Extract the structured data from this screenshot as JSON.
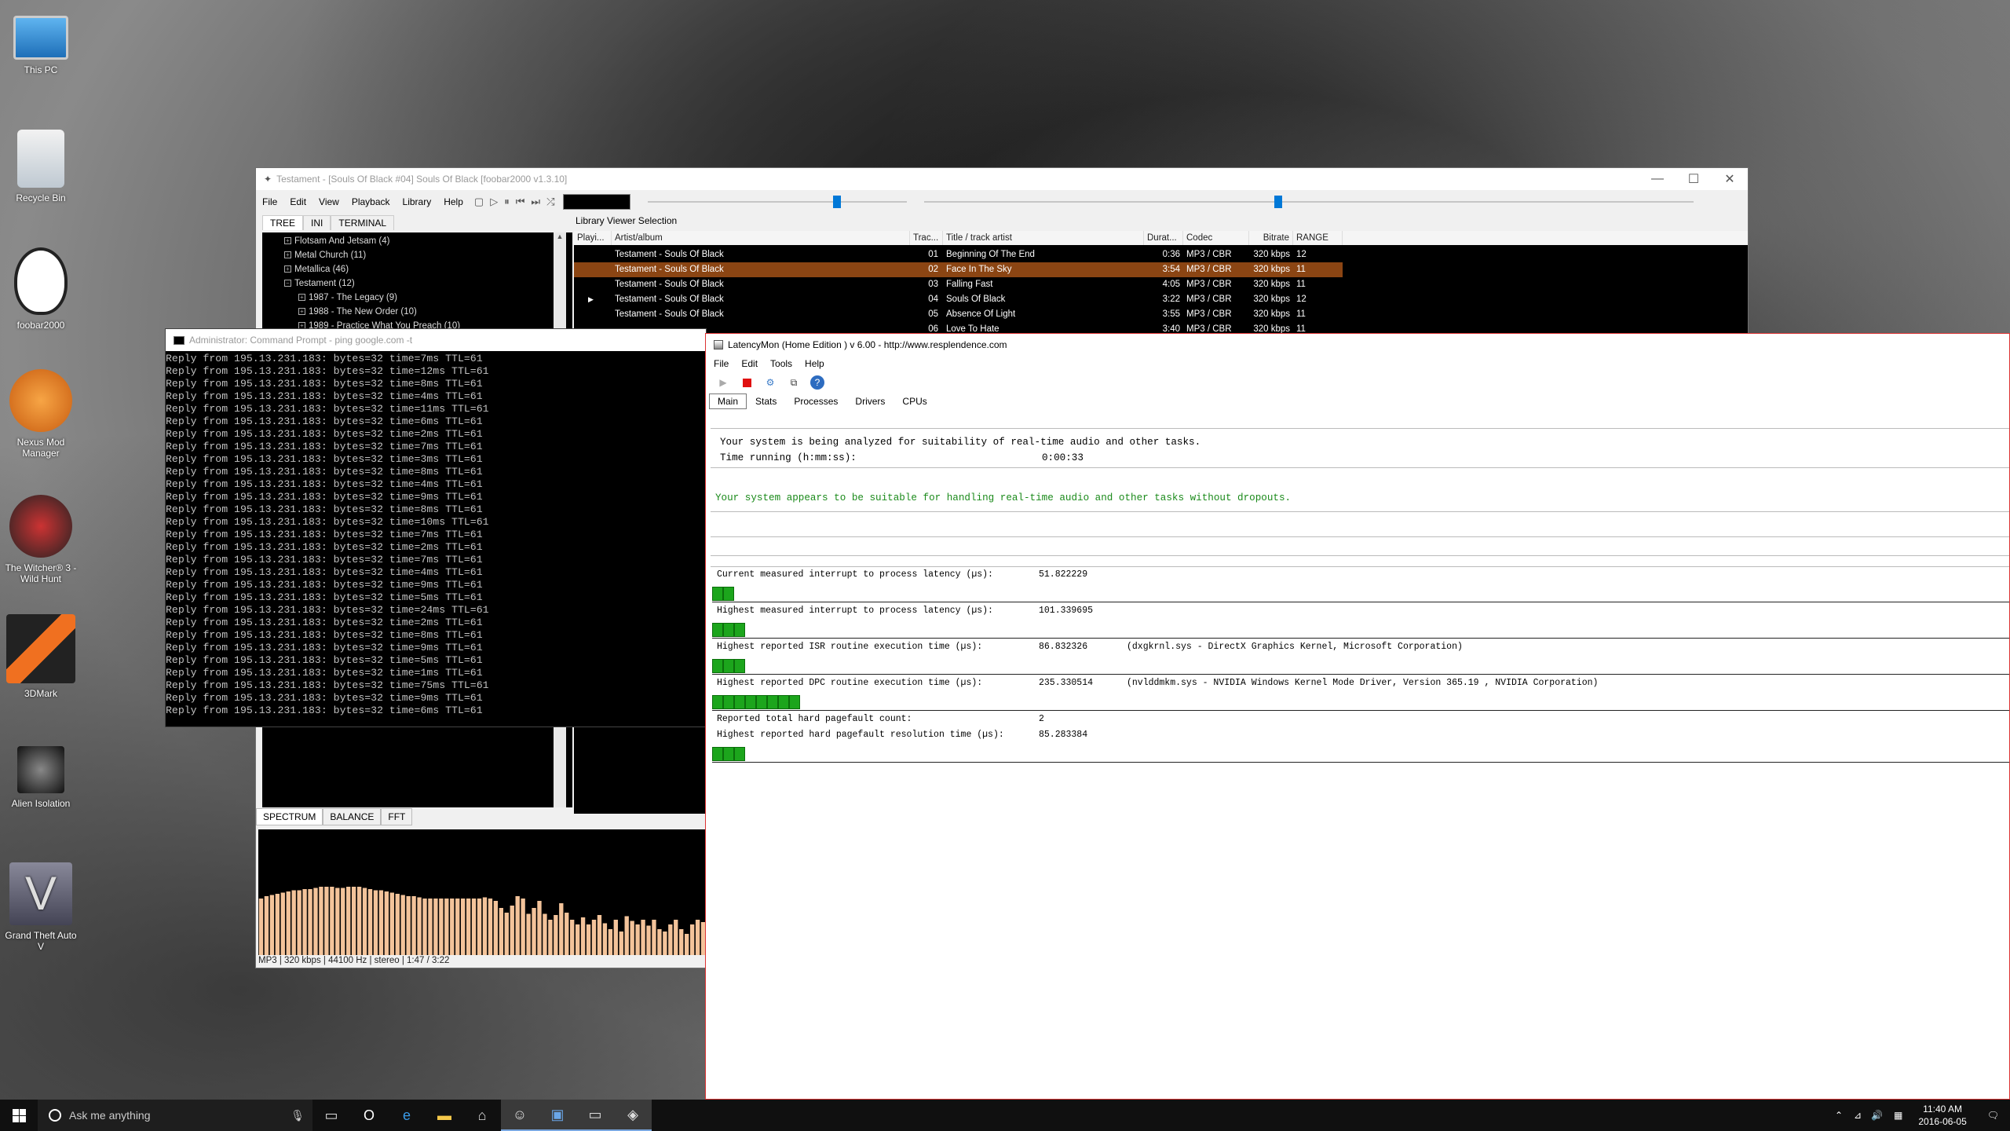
{
  "desktop": {
    "icons": [
      "This PC",
      "Recycle Bin",
      "foobar2000",
      "Nexus Mod Manager",
      "The Witcher® 3 - Wild Hunt",
      "3DMark",
      "Alien Isolation",
      "Grand Theft Auto V"
    ]
  },
  "foobar": {
    "title": "Testament - [Souls Of Black #04] Souls Of Black  [foobar2000 v1.3.10]",
    "menu": [
      "File",
      "Edit",
      "View",
      "Playback",
      "Library",
      "Help"
    ],
    "tabs": [
      "TREE",
      "INI",
      "TERMINAL"
    ],
    "tree": [
      "Flotsam And Jetsam (4)",
      "Metal Church (11)",
      "Metallica (46)",
      "Testament (12)",
      "1987 - The Legacy (9)",
      "1988 - The New Order (10)",
      "1989 - Practice What You Preach (10)"
    ],
    "library_label": "Library Viewer Selection",
    "columns": [
      "Playi...",
      "Artist/album",
      "Trac...",
      "Title / track artist",
      "Durat...",
      "Codec",
      "Bitrate",
      "RANGE"
    ],
    "rows": [
      {
        "playing": "",
        "artist": "Testament - Souls Of Black",
        "track": "01",
        "title": "Beginning Of The End",
        "duration": "0:36",
        "codec": "MP3 / CBR",
        "bitrate": "320 kbps",
        "range": "12"
      },
      {
        "playing": "",
        "artist": "Testament - Souls Of Black",
        "track": "02",
        "title": "Face In The Sky",
        "duration": "3:54",
        "codec": "MP3 / CBR",
        "bitrate": "320 kbps",
        "range": "11"
      },
      {
        "playing": "",
        "artist": "Testament - Souls Of Black",
        "track": "03",
        "title": "Falling Fast",
        "duration": "4:05",
        "codec": "MP3 / CBR",
        "bitrate": "320 kbps",
        "range": "11"
      },
      {
        "playing": "▶",
        "artist": "Testament - Souls Of Black",
        "track": "04",
        "title": "Souls Of Black",
        "duration": "3:22",
        "codec": "MP3 / CBR",
        "bitrate": "320 kbps",
        "range": "12"
      },
      {
        "playing": "",
        "artist": "Testament - Souls Of Black",
        "track": "05",
        "title": "Absence Of Light",
        "duration": "3:55",
        "codec": "MP3 / CBR",
        "bitrate": "320 kbps",
        "range": "11"
      },
      {
        "playing": "",
        "artist": "",
        "track": "06",
        "title": "Love To Hate",
        "duration": "3:40",
        "codec": "MP3 / CBR",
        "bitrate": "320 kbps",
        "range": "11"
      }
    ],
    "spectrum_tabs": [
      "SPECTRUM",
      "BALANCE",
      "FFT"
    ],
    "status": "MP3 | 320 kbps | 44100 Hz | stereo | 1:47 / 3:22",
    "volume_level": 0.74,
    "seek_level": 0.46,
    "spectrum_levels": [
      0.48,
      0.5,
      0.51,
      0.52,
      0.53,
      0.54,
      0.55,
      0.55,
      0.56,
      0.56,
      0.57,
      0.58,
      0.58,
      0.58,
      0.57,
      0.57,
      0.58,
      0.58,
      0.58,
      0.57,
      0.56,
      0.55,
      0.55,
      0.54,
      0.53,
      0.52,
      0.51,
      0.5,
      0.5,
      0.49,
      0.48,
      0.48,
      0.48,
      0.48,
      0.48,
      0.48,
      0.48,
      0.48,
      0.48,
      0.48,
      0.48,
      0.49,
      0.48,
      0.46,
      0.4,
      0.36,
      0.42,
      0.5,
      0.48,
      0.35,
      0.4,
      0.46,
      0.35,
      0.3,
      0.34,
      0.44,
      0.36,
      0.3,
      0.26,
      0.32,
      0.26,
      0.3,
      0.34,
      0.27,
      0.22,
      0.3,
      0.2,
      0.33,
      0.29,
      0.26,
      0.3,
      0.25,
      0.3,
      0.22,
      0.2,
      0.26,
      0.3,
      0.22,
      0.18,
      0.26,
      0.3,
      0.28
    ]
  },
  "cmd": {
    "title": "Administrator: Command Prompt - ping google.com -t",
    "lines": [
      "Reply from 195.13.231.183: bytes=32 time=7ms TTL=61",
      "Reply from 195.13.231.183: bytes=32 time=12ms TTL=61",
      "Reply from 195.13.231.183: bytes=32 time=8ms TTL=61",
      "Reply from 195.13.231.183: bytes=32 time=4ms TTL=61",
      "Reply from 195.13.231.183: bytes=32 time=11ms TTL=61",
      "Reply from 195.13.231.183: bytes=32 time=6ms TTL=61",
      "Reply from 195.13.231.183: bytes=32 time=2ms TTL=61",
      "Reply from 195.13.231.183: bytes=32 time=7ms TTL=61",
      "Reply from 195.13.231.183: bytes=32 time=3ms TTL=61",
      "Reply from 195.13.231.183: bytes=32 time=8ms TTL=61",
      "Reply from 195.13.231.183: bytes=32 time=4ms TTL=61",
      "Reply from 195.13.231.183: bytes=32 time=9ms TTL=61",
      "Reply from 195.13.231.183: bytes=32 time=8ms TTL=61",
      "Reply from 195.13.231.183: bytes=32 time=10ms TTL=61",
      "Reply from 195.13.231.183: bytes=32 time=7ms TTL=61",
      "Reply from 195.13.231.183: bytes=32 time=2ms TTL=61",
      "Reply from 195.13.231.183: bytes=32 time=7ms TTL=61",
      "Reply from 195.13.231.183: bytes=32 time=4ms TTL=61",
      "Reply from 195.13.231.183: bytes=32 time=9ms TTL=61",
      "Reply from 195.13.231.183: bytes=32 time=5ms TTL=61",
      "Reply from 195.13.231.183: bytes=32 time=24ms TTL=61",
      "Reply from 195.13.231.183: bytes=32 time=2ms TTL=61",
      "Reply from 195.13.231.183: bytes=32 time=8ms TTL=61",
      "Reply from 195.13.231.183: bytes=32 time=9ms TTL=61",
      "Reply from 195.13.231.183: bytes=32 time=5ms TTL=61",
      "Reply from 195.13.231.183: bytes=32 time=1ms TTL=61",
      "Reply from 195.13.231.183: bytes=32 time=75ms TTL=61",
      "Reply from 195.13.231.183: bytes=32 time=9ms TTL=61",
      "Reply from 195.13.231.183: bytes=32 time=6ms TTL=61"
    ]
  },
  "latency": {
    "title": "LatencyMon  (Home Edition )  v 6.00 - http://www.resplendence.com",
    "menu": [
      "File",
      "Edit",
      "Tools",
      "Help"
    ],
    "tabs": [
      "Main",
      "Stats",
      "Processes",
      "Drivers",
      "CPUs"
    ],
    "analyzing": "Your system is being analyzed for suitability of real-time audio and other tasks.",
    "time_label": "Time running (h:mm:ss):",
    "time_value": "0:00:33",
    "verdict": "Your system appears to be suitable for handling real-time audio and other tasks without dropouts.",
    "verdict_color": "#1a8a1a",
    "metrics": [
      {
        "label": "Current measured interrupt to process latency (µs):",
        "value": "51.822229",
        "detail": "",
        "blocks": 2
      },
      {
        "label": "Highest measured interrupt to process latency (µs):",
        "value": "101.339695",
        "detail": "",
        "blocks": 3
      },
      {
        "label": "Highest reported ISR routine execution time (µs):",
        "value": "86.832326",
        "detail": "(dxgkrnl.sys - DirectX Graphics Kernel, Microsoft Corporation)",
        "blocks": 3
      },
      {
        "label": "Highest reported DPC routine execution time (µs):",
        "value": "235.330514",
        "detail": "(nvlddmkm.sys - NVIDIA Windows Kernel Mode Driver, Version 365.19 , NVIDIA Corporation)",
        "blocks": 8
      },
      {
        "label": "Reported total hard pagefault count:",
        "value": "2",
        "detail": "",
        "blocks": 0
      },
      {
        "label": "Highest reported hard pagefault resolution time (µs):",
        "value": "85.283384",
        "detail": "",
        "blocks": 3
      }
    ]
  },
  "taskbar": {
    "search_placeholder": "Ask me anything",
    "clock_time": "11:40 AM",
    "clock_date": "2016-06-05"
  }
}
